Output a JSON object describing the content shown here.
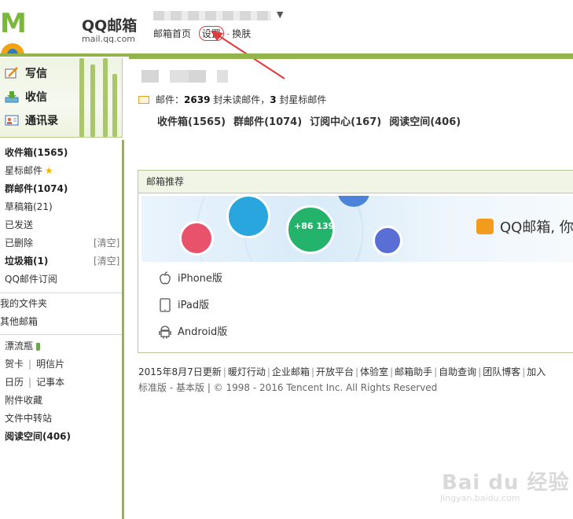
{
  "header": {
    "logo_mark": "MOil",
    "logo_cn": "QQ邮箱",
    "logo_url": "mail.qq.com",
    "account_arrow": "▼",
    "links": [
      {
        "label": "邮箱首页"
      },
      {
        "label": "设置"
      },
      {
        "label": "换肤"
      }
    ]
  },
  "quick_actions": [
    {
      "label": "写信",
      "icon": "compose-icon"
    },
    {
      "label": "收信",
      "icon": "inbox-download-icon"
    },
    {
      "label": "通讯录",
      "icon": "contacts-icon"
    }
  ],
  "folders": {
    "inbox": "收件箱(1565)",
    "starred": "星标邮件",
    "group": "群邮件(1074)",
    "drafts": "草稿箱(21)",
    "sent": "已发送",
    "deleted": "已删除",
    "deleted_clear": "[清空]",
    "spam": "垃圾箱(1)",
    "spam_clear": "[清空]",
    "subscription": "QQ邮件订阅",
    "my_folders": "我的文件夹",
    "other_mailboxes": "其他邮箱",
    "drift_bottle": "漂流瓶",
    "card": "贺卡",
    "postcard": "明信片",
    "calendar": "日历",
    "notebook": "记事本",
    "attachments": "附件收藏",
    "file_transfer": "文件中转站",
    "reading_space": "阅读空间(406)"
  },
  "summary": {
    "prefix": "邮件：",
    "unread_count": "2639",
    "unread_text": " 封未读邮件，",
    "star_count": "3",
    "star_text": " 封星标邮件"
  },
  "big_links": [
    {
      "label": "收件箱(1565)"
    },
    {
      "label": "群邮件(1074)"
    },
    {
      "label": "订阅中心(167)"
    },
    {
      "label": "阅读空间(406)"
    }
  ],
  "promo": {
    "title": "邮箱推荐",
    "phone_badge": "+86 139",
    "banner_text": "QQ邮箱, 你能",
    "devices": [
      {
        "label": "iPhone版",
        "icon": "apple-icon"
      },
      {
        "label": "iPad版",
        "icon": "ipad-icon"
      },
      {
        "label": "Android版",
        "icon": "android-icon"
      }
    ]
  },
  "footer": {
    "line1": [
      "2015年8月7日更新",
      "暖灯行动",
      "企业邮箱",
      "开放平台",
      "体验室",
      "邮箱助手",
      "自助查询",
      "团队博客",
      "加入"
    ],
    "line2_standard": "标准版",
    "line2_dash": " - ",
    "line2_basic": "基本版",
    "line2_copy": " | © 1998 - 2016 Tencent Inc. All Rights Reserved"
  },
  "watermark": {
    "text": "Bai du 经验",
    "url": "jingyan.baidu.com"
  },
  "colors": {
    "brand_green": "#93b44a",
    "highlight_red": "#e03a3a",
    "star": "#f0b400"
  }
}
